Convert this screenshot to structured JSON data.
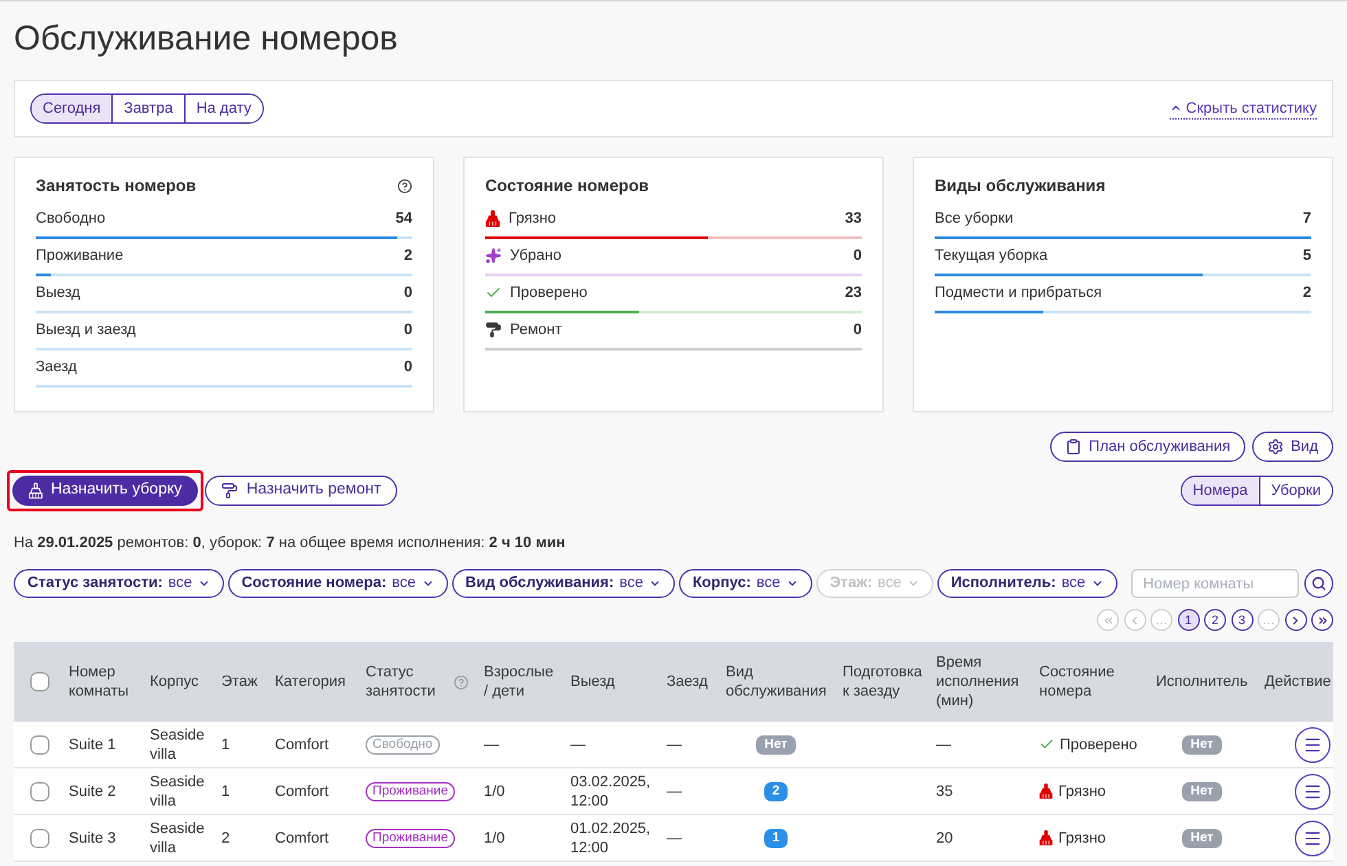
{
  "page": {
    "title": "Обслуживание номеров"
  },
  "toolbar": {
    "periods": [
      {
        "label": "Сегодня",
        "selected": true
      },
      {
        "label": "Завтра",
        "selected": false
      },
      {
        "label": "На дату",
        "selected": false
      }
    ],
    "hide_stats_link": "Скрыть статистику"
  },
  "stats_cards": [
    {
      "title": "Занятость номеров",
      "help": true,
      "rows": [
        {
          "label": "Свободно",
          "value": "54",
          "level": 0.96
        },
        {
          "label": "Проживание",
          "value": "2",
          "level": 0.04
        },
        {
          "label": "Выезд",
          "value": "0",
          "level": 0
        },
        {
          "label": "Выезд и заезд",
          "value": "0",
          "level": 0
        },
        {
          "label": "Заезд",
          "value": "0",
          "level": 0
        }
      ]
    },
    {
      "title": "Состояние номеров",
      "rows": [
        {
          "kind": "dirty",
          "label": "Грязно",
          "value": "33",
          "level": 0.59,
          "color": "#e00000"
        },
        {
          "kind": "cleaned",
          "label": "Убрано",
          "value": "0",
          "level": 0,
          "color": "#a23fd0"
        },
        {
          "kind": "checked",
          "label": "Проверено",
          "value": "23",
          "level": 0.41,
          "color": "#4caf50"
        },
        {
          "kind": "repair",
          "label": "Ремонт",
          "value": "0",
          "level": 0,
          "color": "#3a3a3a"
        }
      ]
    },
    {
      "title": "Виды обслуживания",
      "rows": [
        {
          "label": "Все уборки",
          "value": "7",
          "level": 1
        },
        {
          "label": "Текущая уборка",
          "value": "5",
          "level": 0.71
        },
        {
          "label": "Подмести и прибраться",
          "value": "2",
          "level": 0.29
        }
      ]
    }
  ],
  "view_buttons": [
    {
      "kind": "plan",
      "label": "План обслуживания"
    },
    {
      "kind": "view",
      "label": "Вид"
    }
  ],
  "actions": [
    {
      "kind": "cleaning",
      "label": "Назначить уборку",
      "primary": true,
      "highlighted": true
    },
    {
      "kind": "repair",
      "label": "Назначить ремонт",
      "primary": false,
      "highlighted": false
    }
  ],
  "mode_tabs": [
    {
      "label": "Номера",
      "selected": true
    },
    {
      "label": "Уборки",
      "selected": false
    }
  ],
  "summary": "На **29.01.2025** ремонтов: **0**, уборок: **7** на общее время исполнения: **2 ч 10 мин**",
  "filters": [
    {
      "label": "Статус занятости:",
      "value": "все",
      "disabled": false
    },
    {
      "label": "Состояние номера:",
      "value": "все",
      "disabled": false
    },
    {
      "label": "Вид обслуживания:",
      "value": "все",
      "disabled": false
    },
    {
      "label": "Корпус:",
      "value": "все",
      "disabled": false
    },
    {
      "label": "Этаж:",
      "value": "все",
      "disabled": true
    },
    {
      "label": "Исполнитель:",
      "value": "все",
      "disabled": false
    }
  ],
  "search": {
    "placeholder": "Номер комнаты"
  },
  "pagination": [
    {
      "kind": "first",
      "selected": false,
      "disabled": true
    },
    {
      "kind": "prev",
      "selected": false,
      "disabled": true
    },
    {
      "kind": "ellipsis",
      "label": "…",
      "selected": false,
      "disabled": true
    },
    {
      "kind": "page",
      "label": "1",
      "selected": true,
      "disabled": false
    },
    {
      "kind": "page",
      "label": "2",
      "selected": false,
      "disabled": false
    },
    {
      "kind": "page",
      "label": "3",
      "selected": false,
      "disabled": false
    },
    {
      "kind": "ellipsis",
      "label": "…",
      "selected": false,
      "disabled": true
    },
    {
      "kind": "next",
      "selected": false,
      "disabled": false
    },
    {
      "kind": "last",
      "selected": false,
      "disabled": false
    }
  ],
  "table": {
    "select_all": {
      "checked": false
    },
    "columns": [
      {
        "label": "Номер комнаты"
      },
      {
        "label": "Корпус"
      },
      {
        "label": "Этаж"
      },
      {
        "label": "Категория"
      },
      {
        "label": "Статус занятости",
        "help": true
      },
      {
        "label": "Взрослые / дети"
      },
      {
        "label": "Выезд"
      },
      {
        "label": "Заезд"
      },
      {
        "label": "Вид обслуживания"
      },
      {
        "label": "Подготовка к заезду"
      },
      {
        "label": "Время исполнения (мин)"
      },
      {
        "label": "Состояние номера"
      },
      {
        "label": "Исполнитель"
      },
      {
        "label": "Действие"
      }
    ],
    "rows": [
      {
        "checked": false,
        "room": "Suite 1",
        "building": "Seaside villa",
        "floor": "1",
        "category": "Comfort",
        "occupancy": {
          "label": "Свободно",
          "color": "#9aa0a8"
        },
        "guests": "—",
        "departure": "—",
        "arrival": "—",
        "service": {
          "label": "Нет",
          "color": "#9aa1ae"
        },
        "time": "—",
        "state": {
          "kind": "checked",
          "label": "Проверено"
        },
        "executor": "Нет"
      },
      {
        "checked": false,
        "room": "Suite 2",
        "building": "Seaside villa",
        "floor": "1",
        "category": "Comfort",
        "occupancy": {
          "label": "Проживание",
          "color": "#a42fc0"
        },
        "guests": "1/0",
        "departure": "03.02.2025, 12:00",
        "arrival": "—",
        "service": {
          "label": "2",
          "color": "#2b8fe8"
        },
        "time": "35",
        "state": {
          "kind": "dirty",
          "label": "Грязно"
        },
        "executor": "Нет"
      },
      {
        "checked": false,
        "room": "Suite 3",
        "building": "Seaside villa",
        "floor": "2",
        "category": "Comfort",
        "occupancy": {
          "label": "Проживание",
          "color": "#a42fc0"
        },
        "guests": "1/0",
        "departure": "01.02.2025, 12:00",
        "arrival": "—",
        "service": {
          "label": "1",
          "color": "#2b8fe8"
        },
        "time": "20",
        "state": {
          "kind": "dirty",
          "label": "Грязно"
        },
        "executor": "Нет"
      }
    ]
  }
}
